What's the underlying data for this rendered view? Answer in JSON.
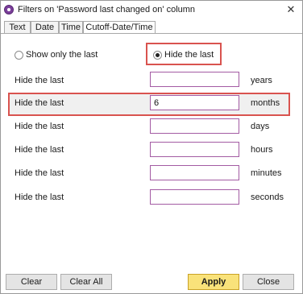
{
  "window": {
    "title": "Filters on 'Password last changed on' column",
    "close_glyph": "✕"
  },
  "tabs": [
    {
      "label": "Text"
    },
    {
      "label": "Date"
    },
    {
      "label": "Time"
    },
    {
      "label": "Cutoff-Date/Time",
      "active": true
    }
  ],
  "mode": {
    "show_only_last_label": "Show only the last",
    "hide_last_label": "Hide the last",
    "selected": "hide_last"
  },
  "rows": [
    {
      "label": "Hide the last",
      "value": "",
      "unit": "years"
    },
    {
      "label": "Hide the last",
      "value": "6",
      "unit": "months"
    },
    {
      "label": "Hide the last",
      "value": "",
      "unit": "days"
    },
    {
      "label": "Hide the last",
      "value": "",
      "unit": "hours"
    },
    {
      "label": "Hide the last",
      "value": "",
      "unit": "minutes"
    },
    {
      "label": "Hide the last",
      "value": "",
      "unit": "seconds"
    }
  ],
  "buttons": {
    "clear": "Clear",
    "clear_all": "Clear All",
    "apply": "Apply",
    "close": "Close"
  },
  "colors": {
    "highlight": "#d9534f",
    "apply_bg": "#f9e27a",
    "input_border": "#a35ba3"
  }
}
